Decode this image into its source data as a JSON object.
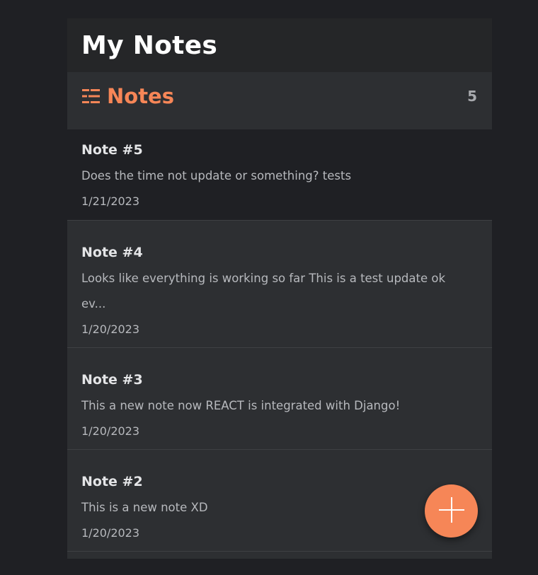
{
  "app": {
    "title": "My Notes"
  },
  "notes_header": {
    "title": "Notes",
    "count": "5",
    "icon": "list-icon"
  },
  "notes": [
    {
      "title": "Note #5",
      "preview": "Does the time not update or something? tests",
      "date": "1/21/2023"
    },
    {
      "title": "Note #4",
      "preview": "Looks like everything is working so far This is a test update ok ev...",
      "date": "1/20/2023"
    },
    {
      "title": "Note #3",
      "preview": "This a new note now REACT is integrated with Django!",
      "date": "1/20/2023"
    },
    {
      "title": "Note #2",
      "preview": "This is a new note XD",
      "date": "1/20/2023"
    }
  ],
  "add_button": {
    "icon": "plus-icon"
  },
  "colors": {
    "accent": "#f68657",
    "background": "#1f2024",
    "panel": "#2d2f32",
    "header": "#252628"
  }
}
